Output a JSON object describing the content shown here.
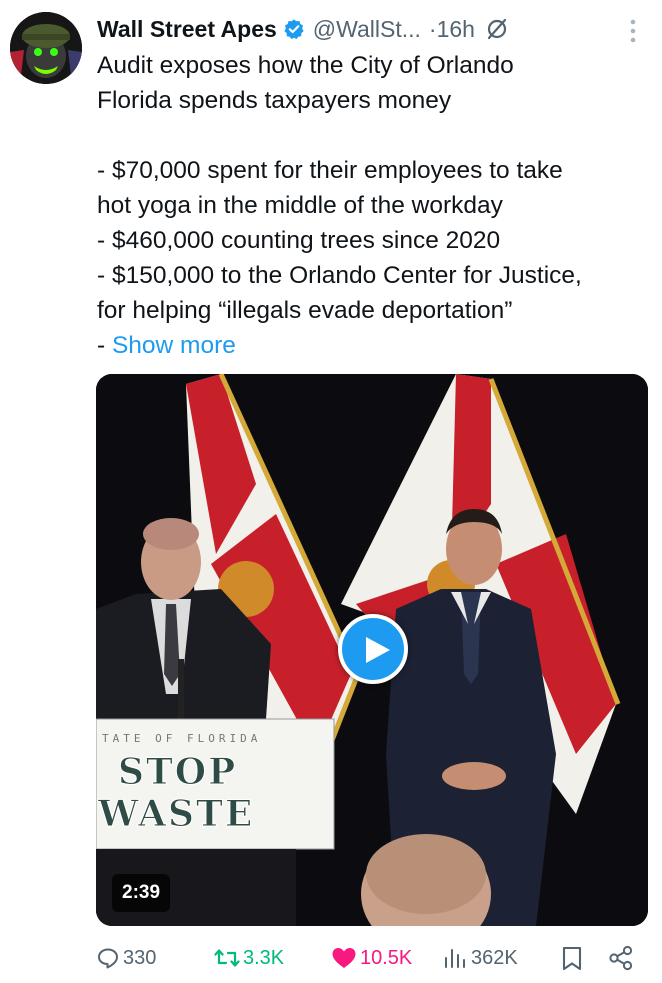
{
  "tweet": {
    "author_name": "Wall Street Apes",
    "handle": "@WallSt...",
    "time": "·16h",
    "lines": [
      "Audit exposes how the City of Orlando",
      "Florida spends taxpayers money",
      "- $70,000 spent for their employees to take",
      "hot yoga in the middle of the workday",
      "- $460,000 counting trees since 2020",
      "- $150,000 to the Orlando Center for Justice,",
      "for helping “illegals evade deportation”"
    ],
    "show_more_prefix": "- ",
    "show_more_label": "Show more"
  },
  "video": {
    "duration": "2:39",
    "podium_top": "TATE  OF  FLORIDA",
    "podium_line1": "STOP",
    "podium_line2": "WASTE"
  },
  "actions": {
    "replies": "330",
    "reposts": "3.3K",
    "likes": "10.5K",
    "views": "362K"
  },
  "colors": {
    "accent": "#1d9bf0",
    "like": "#f91880",
    "repost": "#00ba7c",
    "muted": "#536471"
  }
}
